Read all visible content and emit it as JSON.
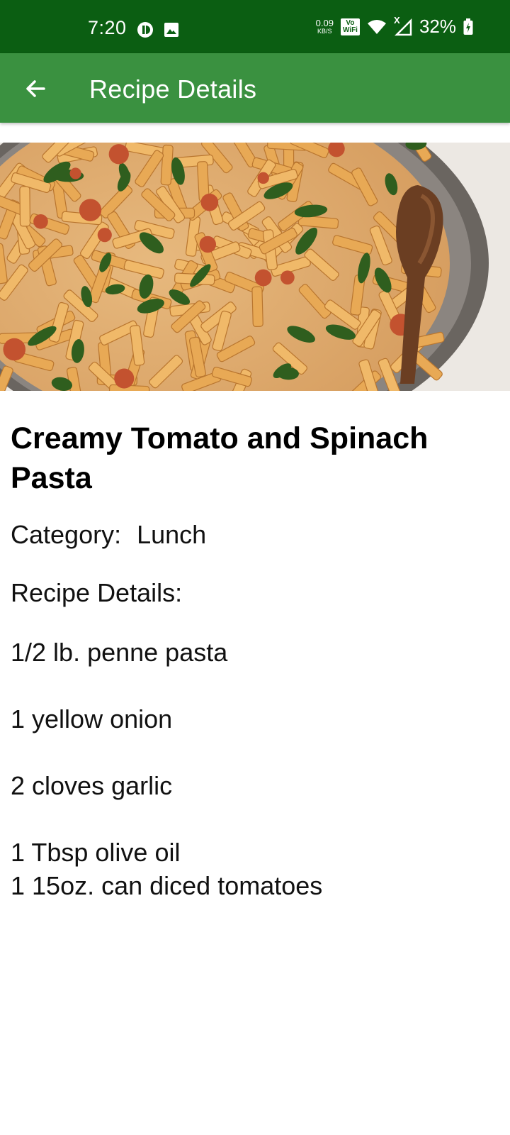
{
  "status_bar": {
    "time": "7:20",
    "net_speed_value": "0.09",
    "net_speed_unit": "KB/S",
    "vowifi_top": "Vo",
    "vowifi_bottom": "WiFi",
    "signal_badge": "X",
    "battery": "32%"
  },
  "app_bar": {
    "title": "Recipe Details",
    "back_icon": "arrow-left-icon"
  },
  "recipe": {
    "image_alt": "penne pasta with tomato, spinach and wooden spoon",
    "title": "Creamy Tomato and Spinach Pasta",
    "category_label": "Category:",
    "category_value": "Lunch",
    "details_label": "Recipe Details:",
    "ingredients": [
      "1/2 lb. penne pasta",
      "",
      "1 yellow onion",
      "",
      "2 cloves garlic",
      "",
      "1 Tbsp olive oil",
      "1 15oz. can diced tomatoes"
    ]
  },
  "colors": {
    "status_bar": "#0b5e12",
    "app_bar": "#3a9140",
    "text": "#111111"
  }
}
